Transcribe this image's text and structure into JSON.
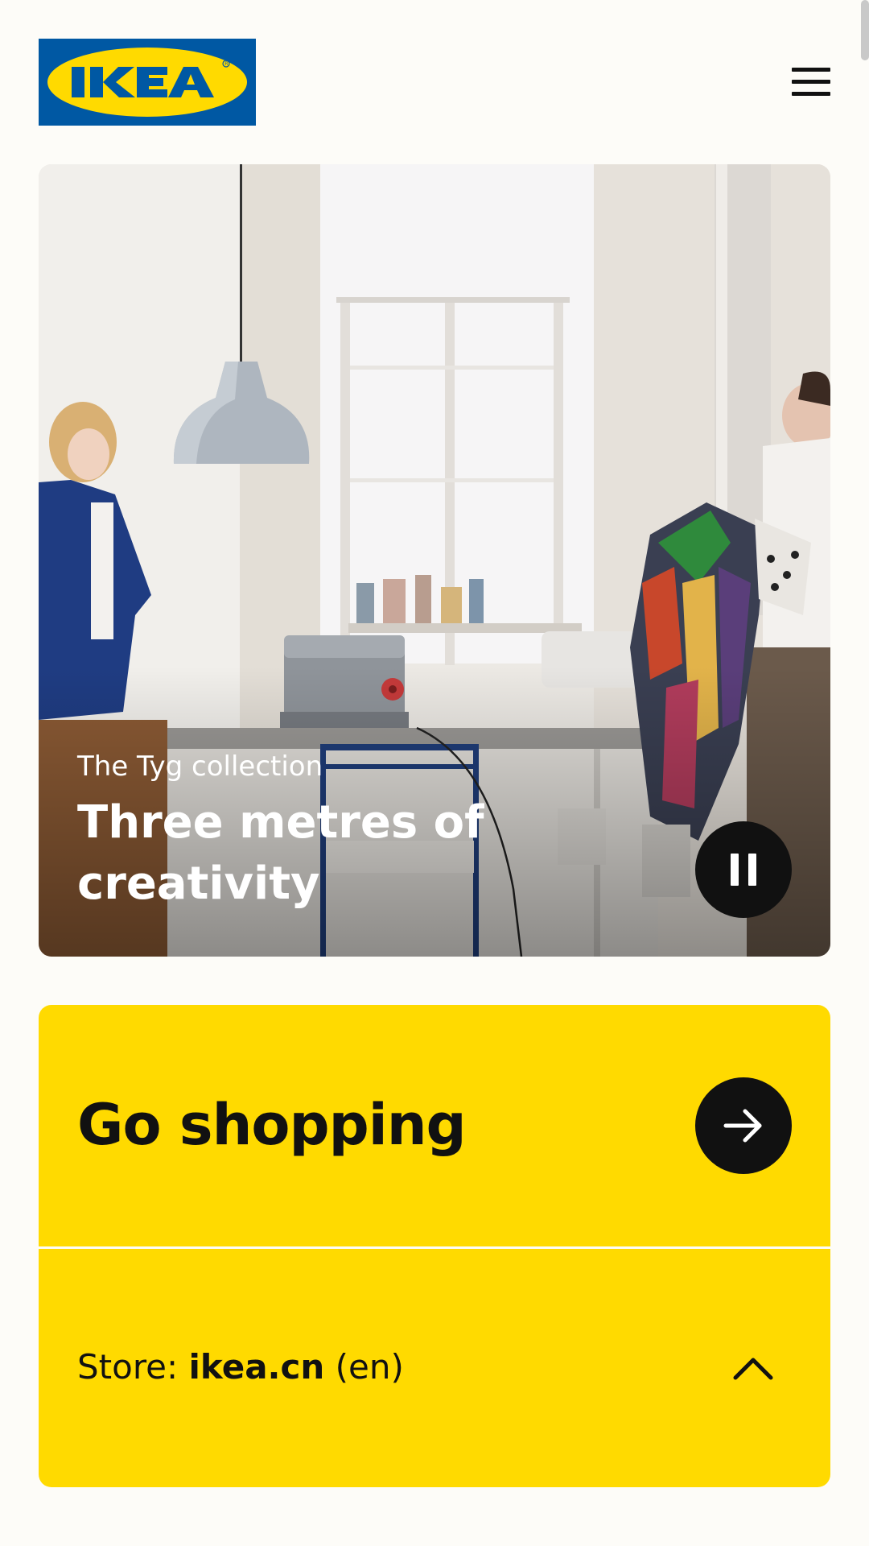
{
  "header": {
    "logo_text": "IKEA",
    "logo_colors": {
      "blue": "#0058a3",
      "yellow": "#ffda00"
    },
    "menu_icon": "hamburger-menu-icon"
  },
  "hero": {
    "subtitle": "The Tyg collection",
    "title": "Three metres of creativity",
    "control_icon": "pause-icon"
  },
  "shop": {
    "label": "Go shopping",
    "icon": "arrow-right-icon",
    "color": "#ffda00"
  },
  "store": {
    "prefix": "Store: ",
    "domain": "ikea.cn",
    "language": " (en)",
    "icon": "chevron-up-icon"
  }
}
